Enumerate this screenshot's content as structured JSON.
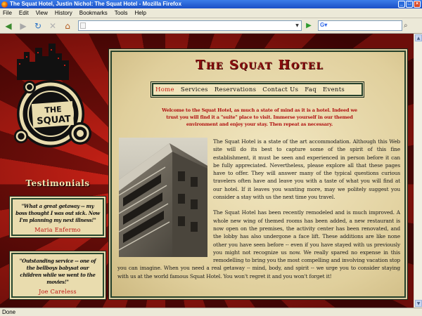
{
  "window": {
    "title": "The Squat Hotel, Justin Nichol: The Squat Hotel - Mozilla Firefox"
  },
  "menu": [
    "File",
    "Edit",
    "View",
    "History",
    "Bookmarks",
    "Tools",
    "Help"
  ],
  "toolbar": {
    "url_value": "",
    "search_value": ""
  },
  "site": {
    "logo_text": "THE SQUAT",
    "title": "The Squat Hotel",
    "nav": [
      "Home",
      "Services",
      "Reservations",
      "Contact Us",
      "Faq",
      "Events"
    ],
    "active_nav": "Home",
    "welcome": "Welcome to the Squat Hotel, as much a state of mind as it is a hotel. Indeed we trust you will find it a \"suite\" place to visit. Immerse yourself in our themed environment and enjoy your stay. Then repeat as necessary.",
    "paragraphs": [
      "The Squat Hotel is a state of the art accommodation. Although this Web site will do its best to capture some of the spirit of this fine establishment, it must be seen and experienced in person before it can be fully appreciated. Nevertheless, please explore all that these pages have to offer. They will answer many of the typical questions curious travelers often have and leave you with a taste of what you will find at our hotel. If it leaves you wanting more, may we politely suggest you consider a stay with us the next time you travel.",
      "The Squat Hotel has been recently remodeled and is much improved. A whole new wing of themed rooms has been added, a new restaurant is now open on the premises, the activity center has been renovated, and the lobby has also undergone a face lift. These additions are like none other you have seen before -- even if you have stayed with us previously you might not recognize us now. We really spared no expense in this remodelling to bring you the most compelling and involving vacation stop you can imagine. When you need a real getaway -- mind, body, and spirit -- we urge you to consider staying with us at the world famous Squat Hotel. You won't regret it and you won't forget it!"
    ],
    "testimonials_heading": "Testimonials",
    "testimonials": [
      {
        "quote": "\"What a great getaway -- my boss thought I was out sick. Now I'm planning my next illness!\"",
        "author": "Maria Enfermo"
      },
      {
        "quote": "\"Outstanding service -- one of the bellboys babysat our children while we went to the movies!\"",
        "author": "Joe Careless"
      }
    ]
  },
  "status": {
    "text": "Done"
  },
  "colors": {
    "accent_red": "#8a0e0e",
    "frame_green": "#25402a",
    "parchment": "#f0e4bb"
  }
}
